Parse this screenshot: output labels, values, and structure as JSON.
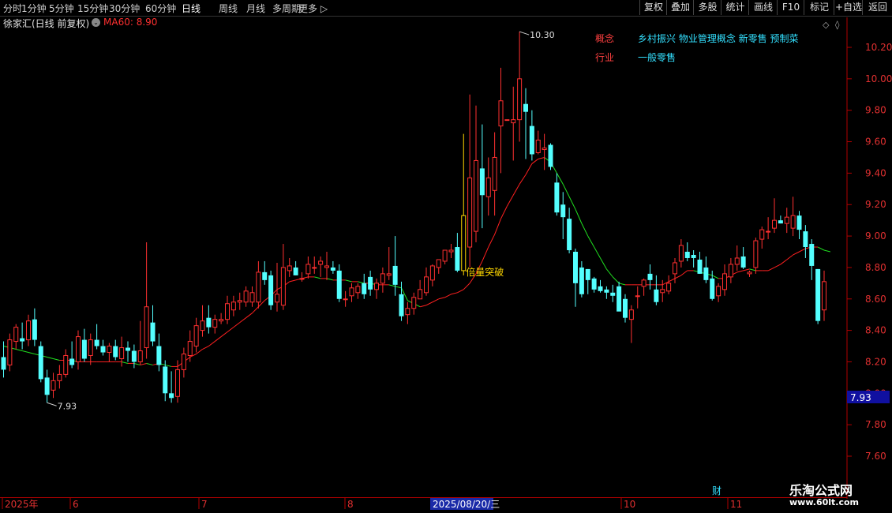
{
  "toolbar": {
    "periods": [
      "分时",
      "1分钟",
      "5分钟",
      "15分钟",
      "30分钟",
      "60分钟",
      "日线",
      "周线",
      "月线",
      "多周期",
      "更多 ▷"
    ],
    "active_period": "日线",
    "buttons": [
      "复权",
      "叠加",
      "多股",
      "统计",
      "画线",
      "F10",
      "标记",
      "+自选",
      "返回"
    ]
  },
  "title": {
    "stock_name": "徐家汇(日线 前复权)",
    "ma_label": "MA60: 8.90"
  },
  "concepts": {
    "concept_label": "概念",
    "concept_value": "乡村振兴 物业管理概念 新零售 预制菜",
    "industry_label": "行业",
    "industry_value": "一般零售"
  },
  "annotation_text": "倍量突破",
  "marker_fin": "财",
  "current_price_box": "7.93",
  "watermark": {
    "brand": "乐淘公式网",
    "url": "www.60lt.com"
  },
  "colors": {
    "up": "#ff3030",
    "down": "#54ffff",
    "ma_up": "#ff2020",
    "ma_down": "#20e020",
    "axis": "#b00000",
    "highlight": "#ffd700"
  },
  "chart_data": {
    "type": "candlestick",
    "ylim": [
      7.55,
      10.33
    ],
    "y_ticks": [
      "7.60",
      "7.80",
      "8.00",
      "8.20",
      "8.40",
      "8.60",
      "8.80",
      "9.00",
      "9.20",
      "9.40",
      "9.60",
      "9.80",
      "10.00",
      "10.20"
    ],
    "x_ticks": [
      "2025年",
      "6",
      "7",
      "8",
      "2025/08/20/三",
      "10",
      "11"
    ],
    "max_label": "10.30",
    "min_label": "7.93",
    "ohlc": [
      [
        8.23,
        8.33,
        8.1,
        8.15
      ],
      [
        8.18,
        8.38,
        8.14,
        8.34
      ],
      [
        8.33,
        8.44,
        8.28,
        8.42
      ],
      [
        8.35,
        8.45,
        8.28,
        8.33
      ],
      [
        8.34,
        8.5,
        8.3,
        8.46
      ],
      [
        8.47,
        8.54,
        8.3,
        8.34
      ],
      [
        8.3,
        8.33,
        8.07,
        8.09
      ],
      [
        8.1,
        8.15,
        7.94,
        7.99
      ],
      [
        8.02,
        8.13,
        7.97,
        8.08
      ],
      [
        8.08,
        8.18,
        8.03,
        8.12
      ],
      [
        8.12,
        8.28,
        8.1,
        8.24
      ],
      [
        8.22,
        8.33,
        8.16,
        8.18
      ],
      [
        8.2,
        8.4,
        8.15,
        8.36
      ],
      [
        8.34,
        8.41,
        8.2,
        8.22
      ],
      [
        8.24,
        8.38,
        8.18,
        8.34
      ],
      [
        8.34,
        8.44,
        8.28,
        8.3
      ],
      [
        8.3,
        8.34,
        8.24,
        8.26
      ],
      [
        8.26,
        8.32,
        8.2,
        8.3
      ],
      [
        8.3,
        8.34,
        8.21,
        8.23
      ],
      [
        8.22,
        8.36,
        8.17,
        8.29
      ],
      [
        8.29,
        8.33,
        8.2,
        8.27
      ],
      [
        8.27,
        8.31,
        8.16,
        8.2
      ],
      [
        8.2,
        8.46,
        8.18,
        8.27
      ],
      [
        8.29,
        8.96,
        8.22,
        8.55
      ],
      [
        8.45,
        8.56,
        8.3,
        8.33
      ],
      [
        8.3,
        8.38,
        8.14,
        8.18
      ],
      [
        8.17,
        8.21,
        7.95,
        8.0
      ],
      [
        8.0,
        8.14,
        7.94,
        7.97
      ],
      [
        7.98,
        8.21,
        7.94,
        8.15
      ],
      [
        8.15,
        8.29,
        8.1,
        8.25
      ],
      [
        8.24,
        8.4,
        8.2,
        8.33
      ],
      [
        8.3,
        8.48,
        8.26,
        8.43
      ],
      [
        8.4,
        8.56,
        8.36,
        8.46
      ],
      [
        8.48,
        8.56,
        8.38,
        8.42
      ],
      [
        8.42,
        8.5,
        8.38,
        8.47
      ],
      [
        8.46,
        8.51,
        8.44,
        8.47
      ],
      [
        8.47,
        8.62,
        8.44,
        8.57
      ],
      [
        8.53,
        8.62,
        8.49,
        8.58
      ],
      [
        8.58,
        8.64,
        8.53,
        8.59
      ],
      [
        8.58,
        8.68,
        8.55,
        8.65
      ],
      [
        8.58,
        8.68,
        8.55,
        8.64
      ],
      [
        8.58,
        8.84,
        8.54,
        8.77
      ],
      [
        8.77,
        8.84,
        8.69,
        8.72
      ],
      [
        8.75,
        8.78,
        8.53,
        8.56
      ],
      [
        8.58,
        8.83,
        8.52,
        8.63
      ],
      [
        8.56,
        8.95,
        8.53,
        8.8
      ],
      [
        8.78,
        8.86,
        8.74,
        8.81
      ],
      [
        8.8,
        8.84,
        8.75,
        8.75
      ],
      [
        8.73,
        8.77,
        8.71,
        8.73
      ],
      [
        8.76,
        8.87,
        8.73,
        8.82
      ],
      [
        8.8,
        8.87,
        8.76,
        8.8
      ],
      [
        8.82,
        8.87,
        8.74,
        8.84
      ],
      [
        8.8,
        8.9,
        8.72,
        8.81
      ],
      [
        8.8,
        8.84,
        8.76,
        8.78
      ],
      [
        8.78,
        8.82,
        8.58,
        8.6
      ],
      [
        8.6,
        8.65,
        8.55,
        8.6
      ],
      [
        8.62,
        8.7,
        8.58,
        8.67
      ],
      [
        8.64,
        8.7,
        8.6,
        8.68
      ],
      [
        8.7,
        8.76,
        8.6,
        8.63
      ],
      [
        8.74,
        8.78,
        8.62,
        8.66
      ],
      [
        8.66,
        8.73,
        8.6,
        8.7
      ],
      [
        8.7,
        8.8,
        8.64,
        8.76
      ],
      [
        8.75,
        8.93,
        8.72,
        8.76
      ],
      [
        8.81,
        9.0,
        8.62,
        8.69
      ],
      [
        8.63,
        8.71,
        8.46,
        8.49
      ],
      [
        8.5,
        8.58,
        8.44,
        8.54
      ],
      [
        8.54,
        8.64,
        8.5,
        8.61
      ],
      [
        8.6,
        8.72,
        8.6,
        8.66
      ],
      [
        8.64,
        8.8,
        8.62,
        8.74
      ],
      [
        8.72,
        8.82,
        8.68,
        8.81
      ],
      [
        8.8,
        8.85,
        8.76,
        8.85
      ],
      [
        8.84,
        8.91,
        8.82,
        8.91
      ],
      [
        8.9,
        8.95,
        8.86,
        8.91
      ],
      [
        8.93,
        9.02,
        8.77,
        8.78
      ],
      [
        8.78,
        9.65,
        8.75,
        9.13
      ],
      [
        8.93,
        9.9,
        8.8,
        9.37
      ],
      [
        9.03,
        9.83,
        8.96,
        9.48
      ],
      [
        9.43,
        9.71,
        9.05,
        9.26
      ],
      [
        9.25,
        9.5,
        9.13,
        9.37
      ],
      [
        9.29,
        9.66,
        9.13,
        9.5
      ],
      [
        9.7,
        10.07,
        9.4,
        9.86
      ],
      [
        9.74,
        9.74,
        9.74,
        9.74
      ],
      [
        9.72,
        9.95,
        9.48,
        9.74
      ],
      [
        9.74,
        10.3,
        9.6,
        10.0
      ],
      [
        9.84,
        9.94,
        9.49,
        9.79
      ],
      [
        9.7,
        9.8,
        9.48,
        9.52
      ],
      [
        9.53,
        9.67,
        9.52,
        9.61
      ],
      [
        9.55,
        9.65,
        9.42,
        9.56
      ],
      [
        9.58,
        9.59,
        9.42,
        9.44
      ],
      [
        9.34,
        9.4,
        9.13,
        9.15
      ],
      [
        9.2,
        9.28,
        8.98,
        9.12
      ],
      [
        9.11,
        9.18,
        8.89,
        8.91
      ],
      [
        8.9,
        8.92,
        8.55,
        8.7
      ],
      [
        8.8,
        8.84,
        8.61,
        8.63
      ],
      [
        8.79,
        8.79,
        8.63,
        8.72
      ],
      [
        8.73,
        8.74,
        8.64,
        8.66
      ],
      [
        8.68,
        8.72,
        8.64,
        8.65
      ],
      [
        8.66,
        8.68,
        8.6,
        8.64
      ],
      [
        8.64,
        8.69,
        8.58,
        8.62
      ],
      [
        8.68,
        8.71,
        8.6,
        8.52
      ],
      [
        8.6,
        8.63,
        8.45,
        8.48
      ],
      [
        8.47,
        8.56,
        8.32,
        8.53
      ],
      [
        8.62,
        8.68,
        8.54,
        8.62
      ],
      [
        8.68,
        8.73,
        8.62,
        8.72
      ],
      [
        8.76,
        8.82,
        8.66,
        8.72
      ],
      [
        8.66,
        8.75,
        8.56,
        8.58
      ],
      [
        8.64,
        8.72,
        8.58,
        8.66
      ],
      [
        8.65,
        8.75,
        8.63,
        8.7
      ],
      [
        8.76,
        8.86,
        8.7,
        8.83
      ],
      [
        8.84,
        8.98,
        8.8,
        8.94
      ],
      [
        8.9,
        8.96,
        8.84,
        8.86
      ],
      [
        8.88,
        8.91,
        8.8,
        8.86
      ],
      [
        8.85,
        8.9,
        8.76,
        8.76
      ],
      [
        8.8,
        8.87,
        8.7,
        8.72
      ],
      [
        8.73,
        8.78,
        8.59,
        8.6
      ],
      [
        8.62,
        8.7,
        8.58,
        8.68
      ],
      [
        8.66,
        8.82,
        8.62,
        8.76
      ],
      [
        8.74,
        8.86,
        8.7,
        8.82
      ],
      [
        8.82,
        8.94,
        8.78,
        8.86
      ],
      [
        8.87,
        8.93,
        8.79,
        8.8
      ],
      [
        8.76,
        8.78,
        8.74,
        8.77
      ],
      [
        8.8,
        8.99,
        8.76,
        8.97
      ],
      [
        8.98,
        9.06,
        8.92,
        9.04
      ],
      [
        9.03,
        9.12,
        8.98,
        9.03
      ],
      [
        9.05,
        9.24,
        9.02,
        9.1
      ],
      [
        9.1,
        9.13,
        9.08,
        9.08
      ],
      [
        9.08,
        9.18,
        9.02,
        9.12
      ],
      [
        9.05,
        9.25,
        9.0,
        9.13
      ],
      [
        9.13,
        9.16,
        8.98,
        9.04
      ],
      [
        9.03,
        9.07,
        8.86,
        8.93
      ],
      [
        8.95,
        8.98,
        8.72,
        8.81
      ],
      [
        8.79,
        8.79,
        8.44,
        8.46
      ],
      [
        8.53,
        8.78,
        8.46,
        8.71
      ]
    ],
    "ma60": [
      8.3,
      8.29,
      8.28,
      8.27,
      8.26,
      8.25,
      8.24,
      8.23,
      8.22,
      8.21,
      8.21,
      8.21,
      8.2,
      8.2,
      8.2,
      8.2,
      8.2,
      8.2,
      8.2,
      8.2,
      8.19,
      8.19,
      8.18,
      8.19,
      8.18,
      8.19,
      8.18,
      8.17,
      8.17,
      8.2,
      8.23,
      8.25,
      8.28,
      8.3,
      8.33,
      8.36,
      8.39,
      8.42,
      8.45,
      8.48,
      8.51,
      8.55,
      8.59,
      8.62,
      8.66,
      8.68,
      8.71,
      8.72,
      8.73,
      8.74,
      8.74,
      8.73,
      8.73,
      8.72,
      8.72,
      8.72,
      8.71,
      8.71,
      8.7,
      8.7,
      8.69,
      8.69,
      8.69,
      8.68,
      8.67,
      8.59,
      8.57,
      8.55,
      8.56,
      8.58,
      8.6,
      8.61,
      8.63,
      8.64,
      8.66,
      8.7,
      8.76,
      8.84,
      8.93,
      9.01,
      9.11,
      9.19,
      9.26,
      9.33,
      9.39,
      9.46,
      9.49,
      9.5,
      9.47,
      9.4,
      9.33,
      9.25,
      9.17,
      9.08,
      9.0,
      8.93,
      8.86,
      8.79,
      8.74,
      8.7,
      8.69,
      8.69,
      8.69,
      8.69,
      8.69,
      8.69,
      8.69,
      8.71,
      8.73,
      8.75,
      8.78,
      8.78,
      8.77,
      8.76,
      8.75,
      8.73,
      8.73,
      8.75,
      8.77,
      8.78,
      8.79,
      8.78,
      8.78,
      8.78,
      8.8,
      8.82,
      8.85,
      8.88,
      8.9,
      8.92,
      8.93,
      8.93,
      8.91,
      8.9
    ]
  }
}
